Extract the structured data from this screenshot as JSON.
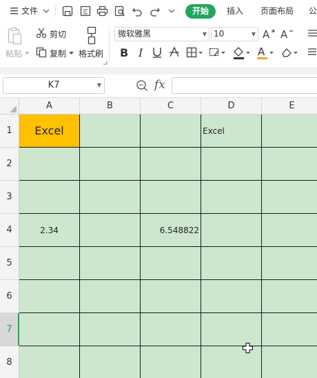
{
  "menubar": {
    "file_label": "文件",
    "tabs": [
      {
        "label": "开始",
        "active": true
      },
      {
        "label": "插入",
        "active": false
      },
      {
        "label": "页面布局",
        "active": false
      },
      {
        "label": "公",
        "active": false
      }
    ]
  },
  "ribbon": {
    "paste_label": "粘贴",
    "cut_label": "剪切",
    "copy_label": "复制",
    "format_painter_label": "格式刷",
    "font_name": "微软雅黑",
    "font_size": "10",
    "font_color_accent": "#f5a623"
  },
  "formula_bar": {
    "cell_ref": "K7",
    "fx_label": "fx",
    "formula_value": ""
  },
  "sheet": {
    "columns": [
      "A",
      "B",
      "C",
      "D",
      "E"
    ],
    "rows": [
      "1",
      "2",
      "3",
      "4",
      "5",
      "6",
      "7",
      "8"
    ],
    "active_row": "7",
    "cells": {
      "A1": "Excel",
      "D1": "Excel",
      "A4": "2.34",
      "C4": "6.548822"
    },
    "fill_color": "#cce7cd",
    "highlight_color": "#ffc000"
  }
}
